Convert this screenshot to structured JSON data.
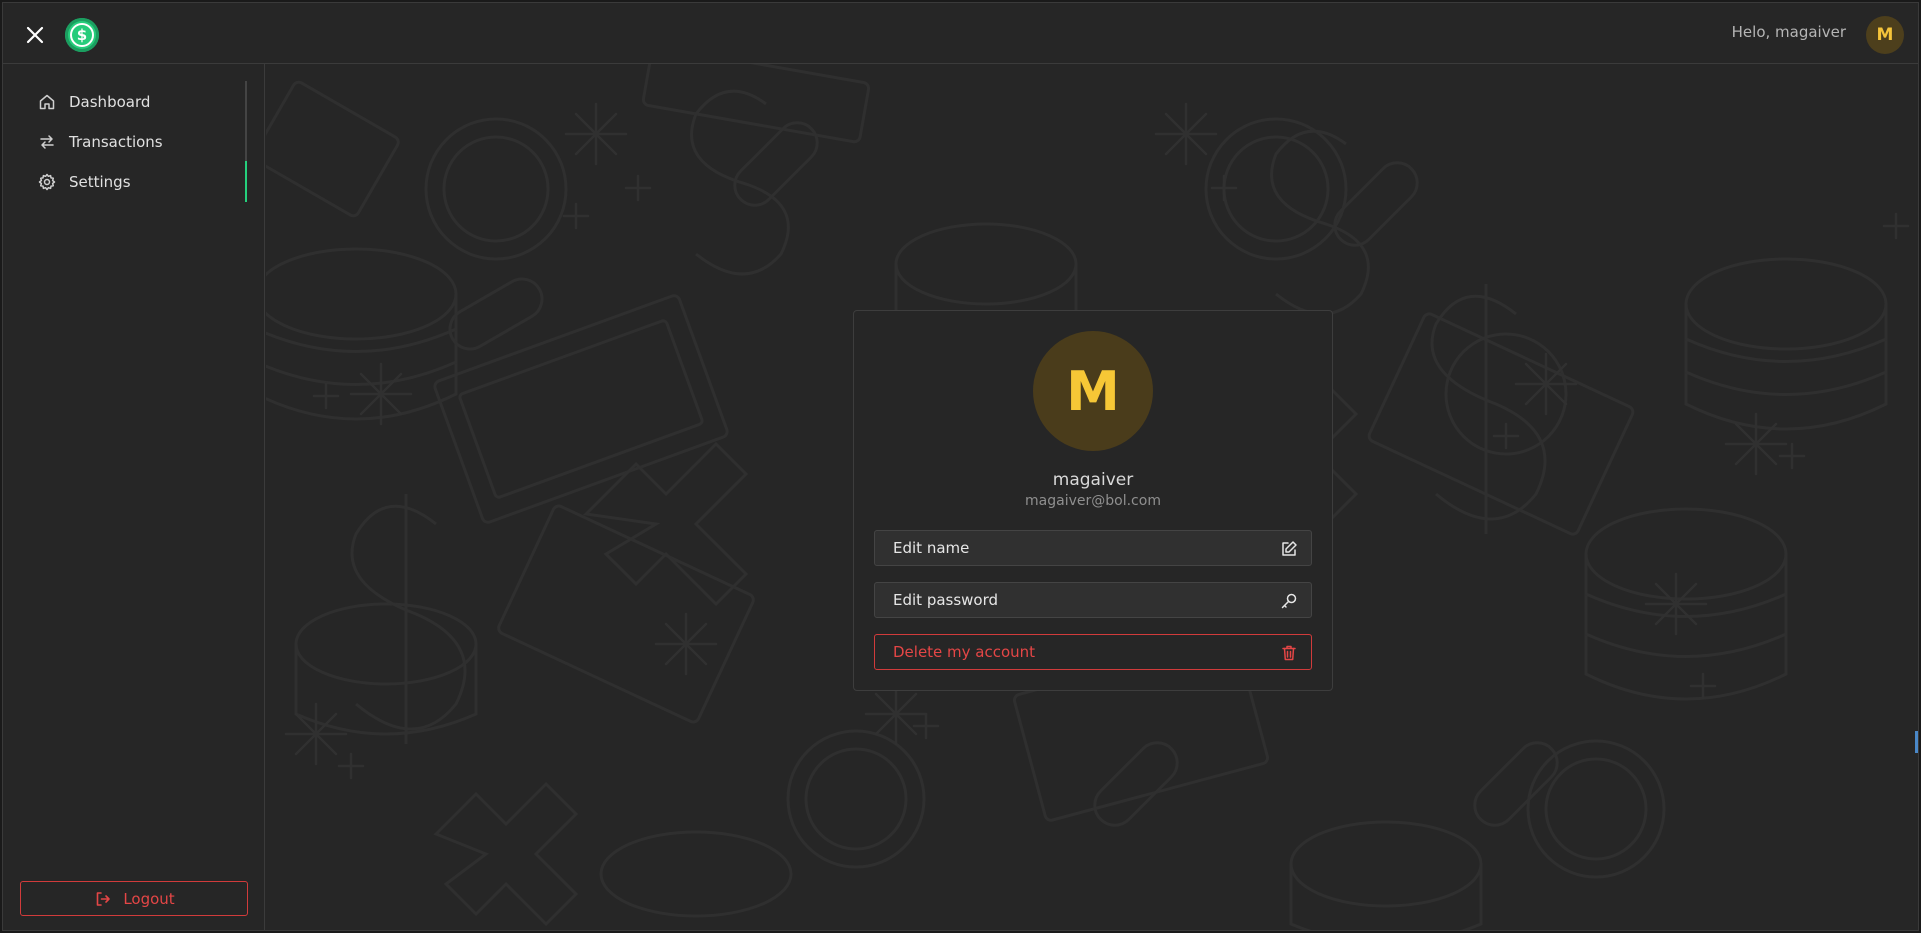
{
  "header": {
    "greeting": "Helo, magaiver",
    "avatar_initial": "M"
  },
  "sidebar": {
    "items": [
      {
        "label": "Dashboard",
        "icon": "home-icon"
      },
      {
        "label": "Transactions",
        "icon": "arrows-swap-icon"
      },
      {
        "label": "Settings",
        "icon": "gear-icon",
        "active": true
      }
    ],
    "logout_label": "Logout"
  },
  "profile": {
    "initial": "M",
    "name": "magaiver",
    "email": "magaiver@bol.com"
  },
  "actions": {
    "edit_name": "Edit name",
    "edit_password": "Edit password",
    "delete_account": "Delete my account"
  },
  "colors": {
    "background": "#262626",
    "accent_green": "#25d07d",
    "danger_red": "#e44646",
    "avatar_bg": "#4a3c1b",
    "avatar_text": "#f6c736"
  }
}
